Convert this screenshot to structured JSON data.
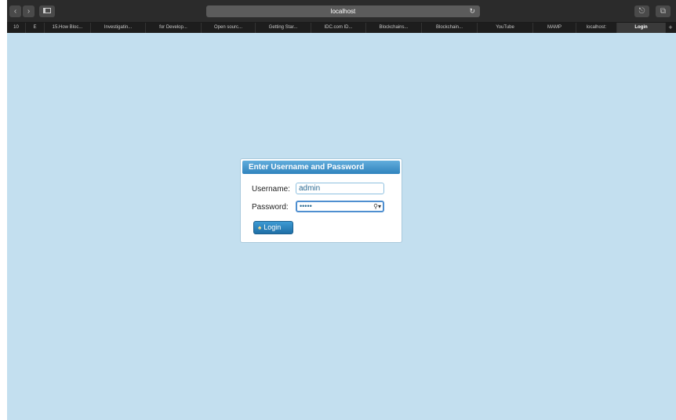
{
  "browser": {
    "url": "localhost",
    "back_icon": "chevron-left-icon",
    "forward_icon": "chevron-right-icon",
    "sidebar_icon": "sidebar-icon",
    "reload_icon": "reload-icon",
    "share_icon": "share-icon",
    "tabs_icon": "tabs-overview-icon",
    "new_tab_label": "+",
    "tabs": [
      {
        "label": "10"
      },
      {
        "label": "E"
      },
      {
        "label": "15.How Bloc..."
      },
      {
        "label": "Investigatin..."
      },
      {
        "label": "for Develop..."
      },
      {
        "label": "Open sourc..."
      },
      {
        "label": "Getting Star..."
      },
      {
        "label": "IDC.com ID..."
      },
      {
        "label": "Blockchains..."
      },
      {
        "label": "Blockchain..."
      },
      {
        "label": "YouTube"
      },
      {
        "label": "MAMP"
      },
      {
        "label": "localhost:"
      },
      {
        "label": "Login",
        "active": true
      }
    ]
  },
  "login": {
    "heading": "Enter Username and Password",
    "username_label": "Username:",
    "username_value": "admin",
    "password_label": "Password:",
    "password_value": "•••••",
    "password_key_icon": "key-dropdown-icon",
    "button_label": "Login",
    "button_icon": "user-login-icon"
  },
  "colors": {
    "page_background": "#c3dfef",
    "header_gradient_top": "#62addc",
    "header_gradient_bottom": "#2f83bd",
    "button_accent": "#1f6fa6"
  }
}
